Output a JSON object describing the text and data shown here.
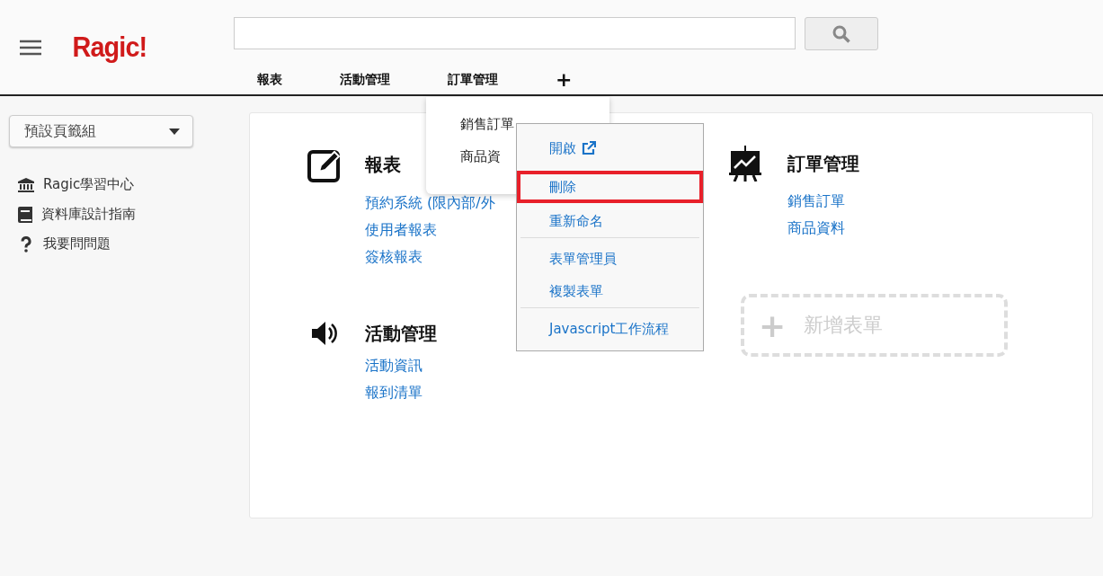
{
  "header": {
    "logo": "Ragic!",
    "tabs": [
      {
        "label": "報表"
      },
      {
        "label": "活動管理"
      },
      {
        "label": "訂單管理"
      }
    ],
    "add_tab": "+"
  },
  "sidebar": {
    "tab_group": "預設頁籤組",
    "links": [
      {
        "kind": "bank",
        "label": "Ragic學習中心"
      },
      {
        "kind": "book",
        "label": "資料庫設計指南"
      },
      {
        "kind": "question",
        "label": "我要問問題"
      }
    ]
  },
  "sections": [
    {
      "kind": "edit",
      "title": "報表",
      "links": [
        "預約系統 (限內部/外",
        "使用者報表",
        "簽核報表"
      ]
    },
    {
      "kind": "chart",
      "title": "訂單管理",
      "links": [
        "銷售訂單",
        "商品資料"
      ]
    },
    {
      "kind": "speaker",
      "title": "活動管理",
      "links": [
        "活動資訊",
        "報到清單"
      ]
    }
  ],
  "add_form": {
    "icon": "+",
    "label": "新增表單"
  },
  "tab_dropdown": {
    "items": [
      "銷售訂單",
      "商品資"
    ]
  },
  "context_menu": {
    "groups": [
      [
        {
          "label": "開啟",
          "kind": "external",
          "highlighted": false
        },
        {
          "label": "刪除",
          "kind": "plain",
          "highlighted": true
        },
        {
          "label": "重新命名",
          "kind": "plain",
          "highlighted": false
        }
      ],
      [
        {
          "label": "表單管理員",
          "kind": "plain",
          "highlighted": false
        },
        {
          "label": "複製表單",
          "kind": "plain",
          "highlighted": false
        }
      ],
      [
        {
          "label": "Javascript工作流程",
          "kind": "plain",
          "highlighted": false
        }
      ]
    ]
  }
}
